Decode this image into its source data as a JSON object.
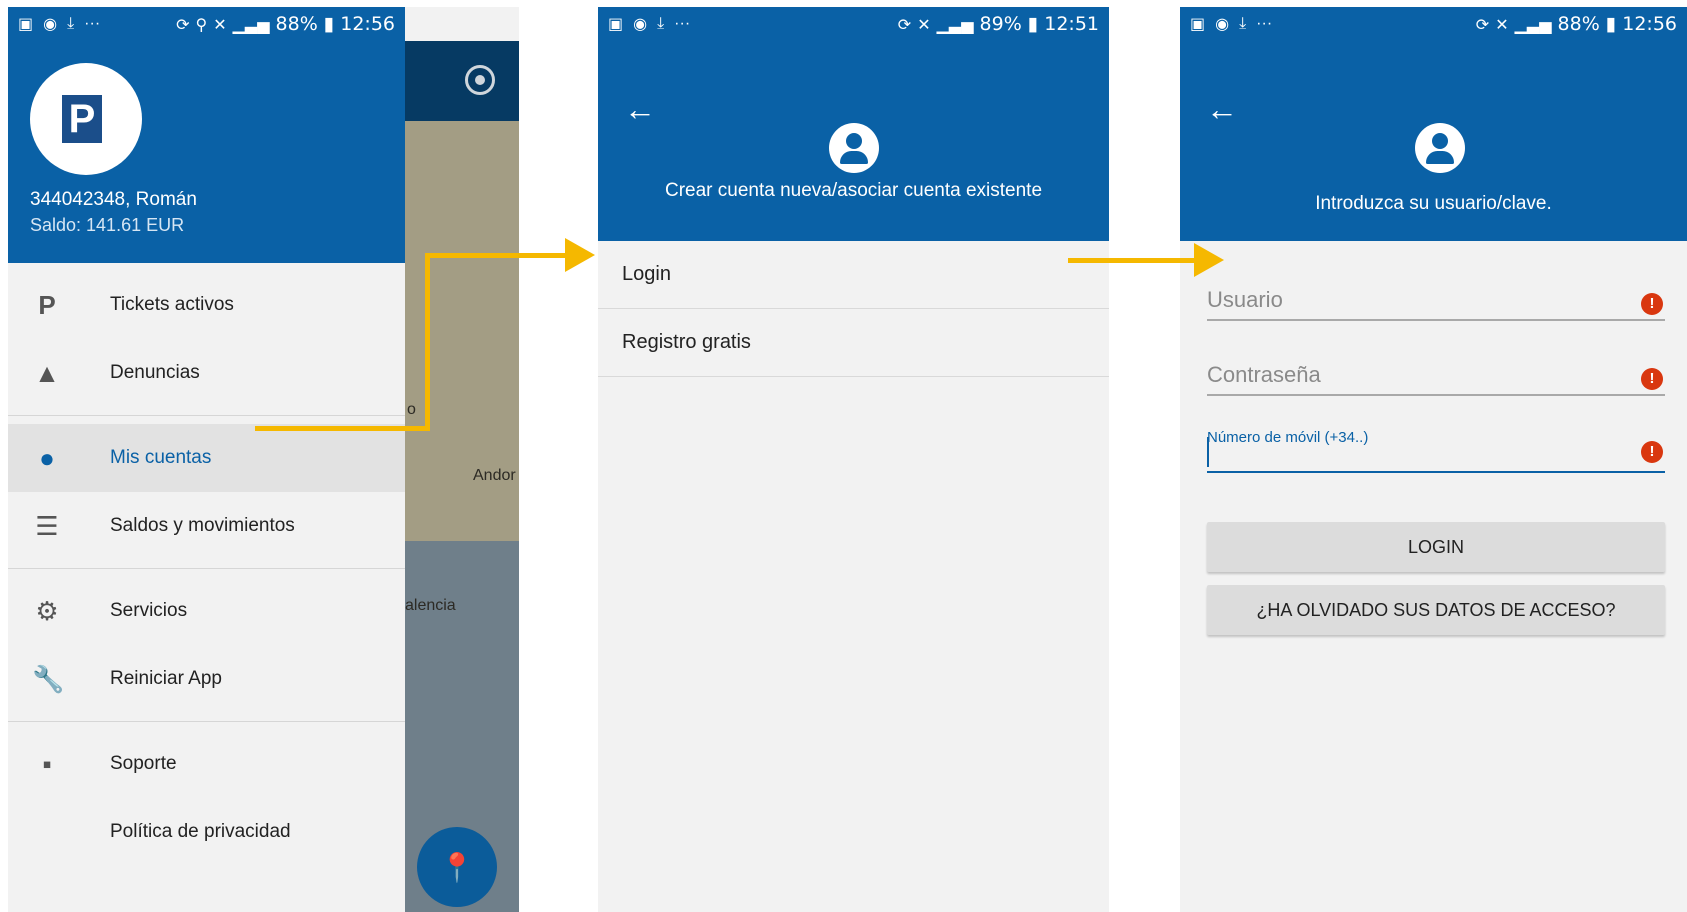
{
  "screens": [
    {
      "status": {
        "battery": "88%",
        "time": "12:56"
      },
      "drawer": {
        "account": "344042348, Román",
        "balance": "Saldo: 141.61 EUR",
        "menu": [
          {
            "label": "Tickets activos",
            "icon": "parking-icon"
          },
          {
            "label": "Denuncias",
            "icon": "warning-icon"
          },
          {
            "label": "Mis cuentas",
            "icon": "account-icon",
            "active": true
          },
          {
            "label": "Saldos y movimientos",
            "icon": "list-icon"
          },
          {
            "label": "Servicios",
            "icon": "gear-icon"
          },
          {
            "label": "Reiniciar App",
            "icon": "wrench-icon"
          },
          {
            "label": "Soporte",
            "icon": "feedback-icon"
          },
          {
            "label": "Política de privacidad",
            "icon": ""
          }
        ]
      },
      "map_labels": [
        "o",
        "Andor",
        "alencia"
      ]
    },
    {
      "status": {
        "battery": "89%",
        "time": "12:51"
      },
      "header_title": "Crear cuenta nueva/asociar cuenta existente",
      "list": [
        "Login",
        "Registro gratis"
      ]
    },
    {
      "status": {
        "battery": "88%",
        "time": "12:56"
      },
      "header_title": "Introduzca su usuario/clave.",
      "fields": {
        "user_placeholder": "Usuario",
        "password_placeholder": "Contraseña",
        "mobile_label": "Número de móvil (+34..)"
      },
      "buttons": {
        "login": "LOGIN",
        "forgot": "¿HA OLVIDADO SUS DATOS DE ACCESO?"
      }
    }
  ],
  "colors": {
    "primary": "#0a61a6",
    "arrow": "#f5b800",
    "error": "#d9370f"
  }
}
